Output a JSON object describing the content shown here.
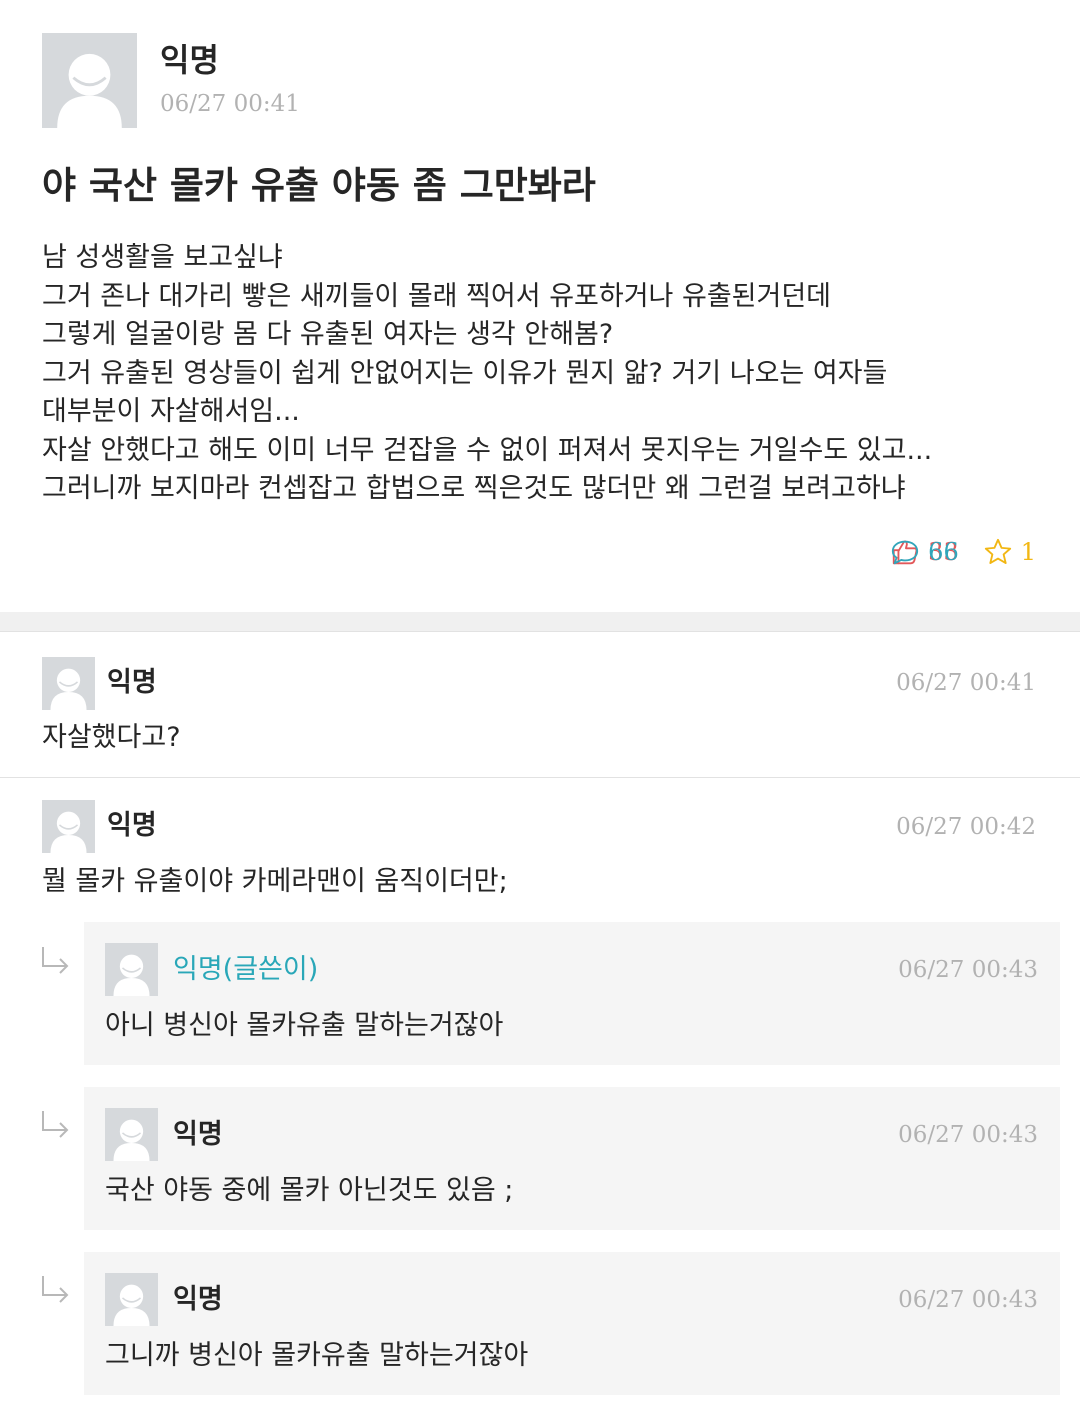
{
  "article": {
    "author": "익명",
    "date": "06/27 00:41",
    "title": "야 국산 몰카 유출 야동 좀 그만봐라",
    "body_lines": [
      "남 성생활을 보고싶냐",
      "그거 존나 대가리 빻은 새끼들이 몰래 찍어서 유포하거나 유출된거던데",
      "그렇게 얼굴이랑 몸 다 유출된 여자는 생각 안해봄?",
      "그거 유출된 영상들이 쉽게 안없어지는 이유가 뭔지 앎? 거기 나오는 여자들",
      "대부분이 자살해서임...",
      "자살 안했다고 해도 이미 너무 걷잡을 수 없이 퍼져서 못지우는 거일수도 있고...",
      "그러니까 보지마라 컨셉잡고 합법으로 찍은것도 많더만 왜 그런걸 보려고하냐"
    ],
    "stats": {
      "likes": "33",
      "comments": "66",
      "scraps": "1"
    },
    "icons": {
      "like": "thumbs-up-icon",
      "comment": "speech-bubble-icon",
      "scrap": "star-icon"
    },
    "colors": {
      "like": "#e2585a",
      "comment": "#32a5ba",
      "scrap": "#f2b713",
      "writer": "#29a7b8"
    }
  },
  "comments": [
    {
      "author": "익명",
      "date": "06/27 00:41",
      "text": "자살했다고?"
    },
    {
      "author": "익명",
      "date": "06/27 00:42",
      "text": "뭘 몰카 유출이야 카메라맨이 움직이더만;",
      "replies": [
        {
          "author": "익명(글쓴이)",
          "date": "06/27 00:43",
          "text": "아니 병신아 몰카유출 말하는거잖아"
        },
        {
          "author": "익명",
          "date": "06/27 00:43",
          "text": "국산 야동 중에 몰카 아닌것도 있음 ;"
        },
        {
          "author": "익명",
          "date": "06/27 00:43",
          "text": "그니까 병신아 몰카유출 말하는거잖아"
        }
      ]
    }
  ]
}
